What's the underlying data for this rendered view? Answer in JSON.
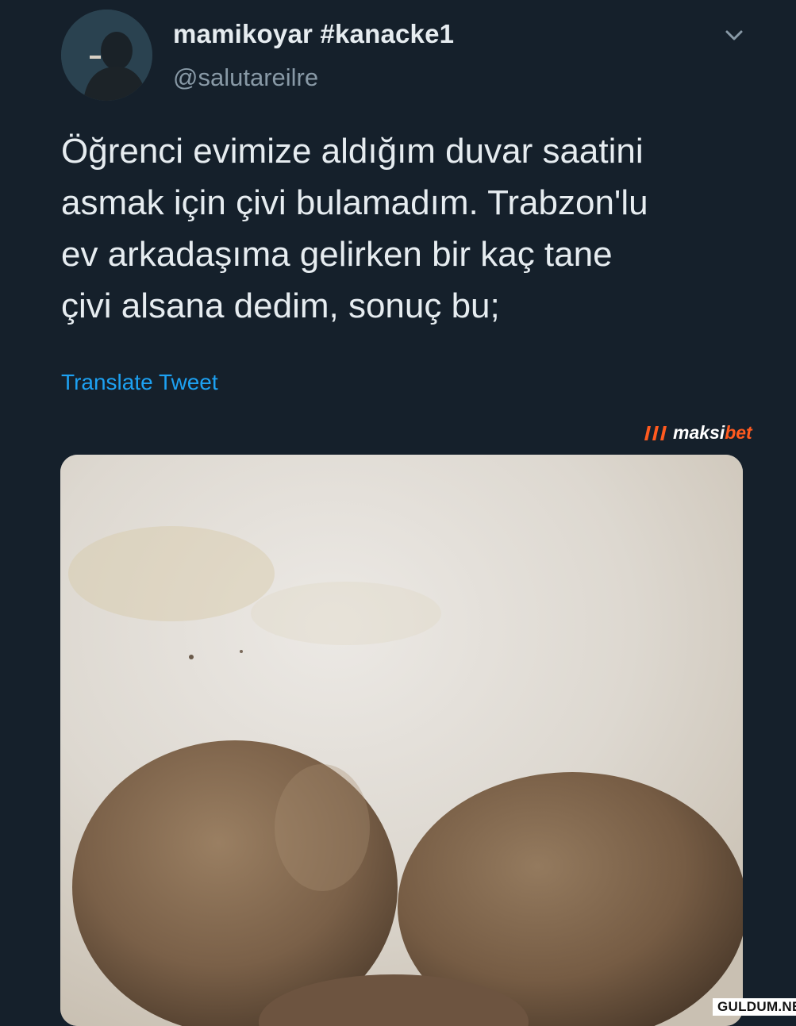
{
  "tweet": {
    "display_name": "mamikoyar #kanacke1",
    "handle": "@salutareilre",
    "text_lines": [
      "Öğrenci evimize aldığım duvar saatini",
      "asmak için çivi bulamadım. Trabzon'lu",
      "ev arkadaşıma gelirken bir kaç tane",
      "çivi alsana dedim, sonuç bu;"
    ],
    "translate_label": "Translate Tweet",
    "more_icon": "chevron-down-icon"
  },
  "overlay": {
    "brand_prefix": "maksi",
    "brand_suffix": "bet",
    "brand_icon": "maksibet-logo-icon",
    "watermark": "GULDUM.NET"
  },
  "colors": {
    "background": "#15202b",
    "text": "#e6ecf0",
    "muted": "#8899a6",
    "link": "#1da1f2",
    "brand_accent": "#ff5a1f"
  }
}
